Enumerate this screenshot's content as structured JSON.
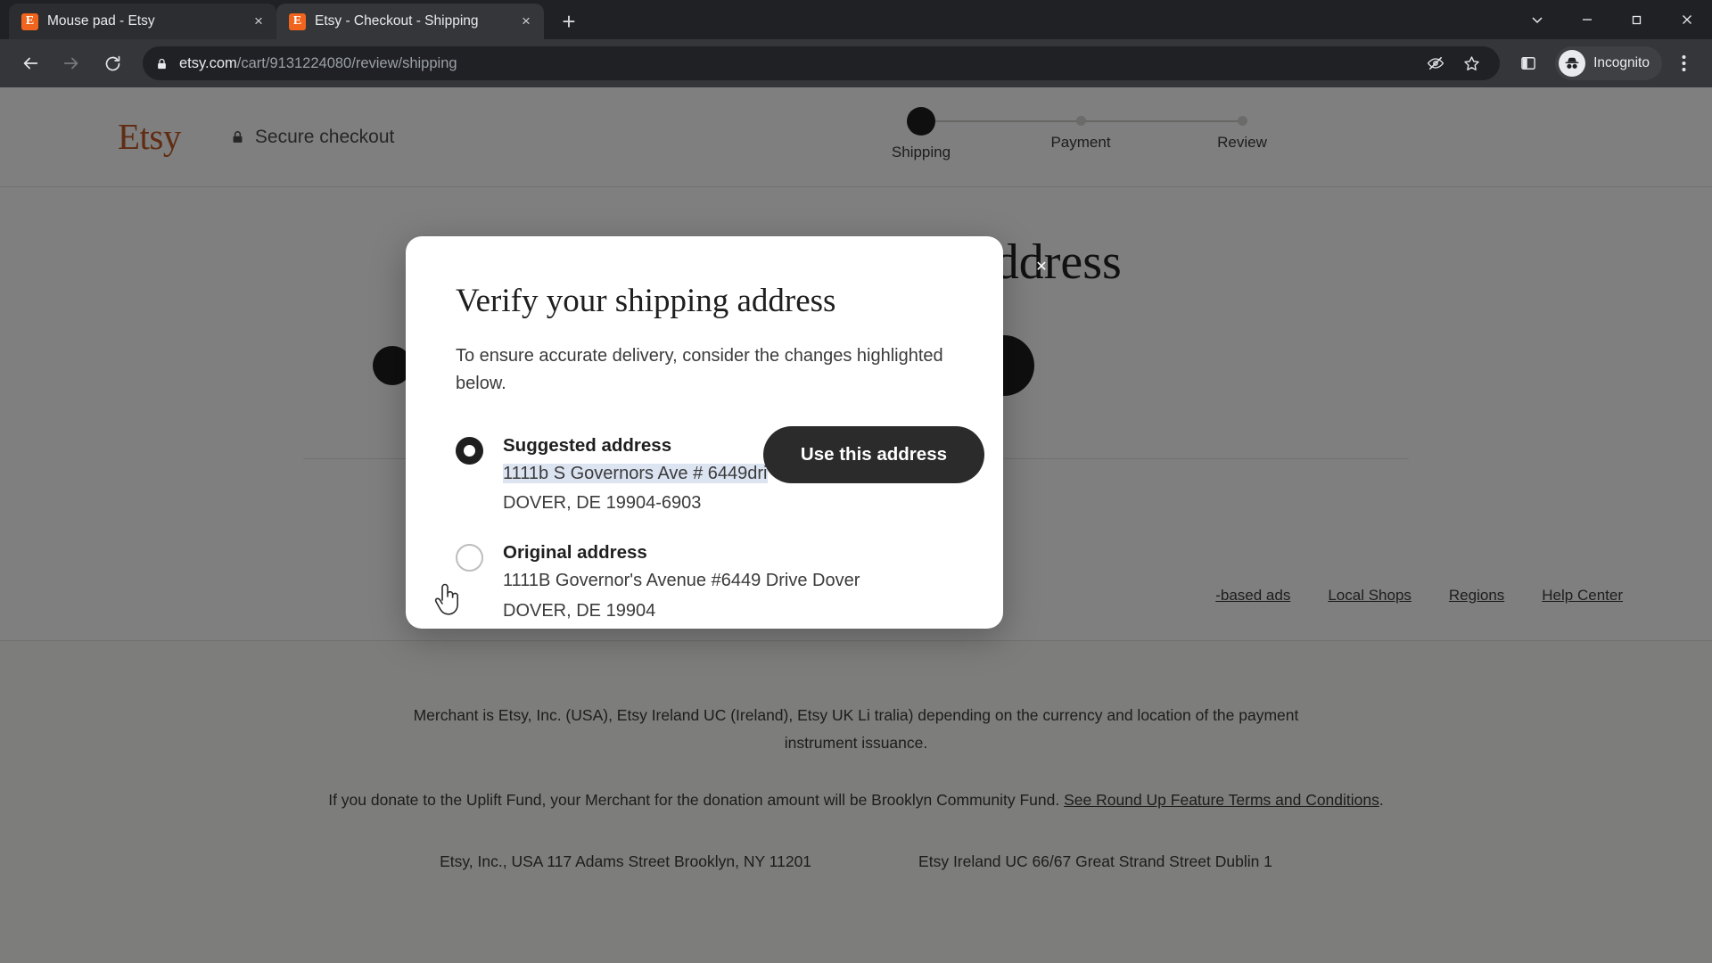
{
  "browser": {
    "tabs": [
      {
        "title": "Mouse pad - Etsy",
        "favicon": "E",
        "active": false
      },
      {
        "title": "Etsy - Checkout - Shipping",
        "favicon": "E",
        "active": true
      }
    ],
    "new_tab_label": "+",
    "close_label": "×",
    "url": {
      "host": "etsy.com",
      "path": "/cart/9131224080/review/shipping"
    },
    "profile_label": "Incognito",
    "window_controls": [
      "chevron-down",
      "minimize",
      "maximize",
      "close"
    ],
    "toolbar_icons": [
      "tracking-protection",
      "bookmark-star",
      "side-panel",
      "incognito-avatar",
      "chrome-menu"
    ]
  },
  "page": {
    "logo": "Etsy",
    "secure_checkout": "Secure checkout",
    "stepper": [
      {
        "label": "Shipping",
        "state": "active"
      },
      {
        "label": "Payment",
        "state": "upcoming"
      },
      {
        "label": "Review",
        "state": "upcoming"
      }
    ],
    "heading": "Choose a shipping address",
    "add_icon": "+",
    "footer_links": [
      "-based ads",
      "Local Shops",
      "Regions",
      "Help Center"
    ],
    "footer": {
      "legal_left": "Merchant is Etsy, Inc. (USA), Etsy Ireland UC (Ireland), Etsy UK Li",
      "legal_right": "tralia) depending on the currency and location of the payment",
      "legal_line2": "instrument issuance.",
      "uplift_pre": "If you donate to the Uplift Fund, your Merchant for the donation amount will be Brooklyn Community Fund. ",
      "uplift_link": "See Round Up Feature Terms and Conditions",
      "uplift_post": ".",
      "address_us": "Etsy, Inc., USA 117 Adams Street Brooklyn, NY 11201",
      "address_ie": "Etsy Ireland UC 66/67 Great Strand Street Dublin 1"
    }
  },
  "modal": {
    "title": "Verify your shipping address",
    "subtitle": "To ensure accurate delivery, consider the changes highlighted below.",
    "close_label": "✕",
    "primary_button": "Use this address",
    "options": [
      {
        "title": "Suggested address",
        "selected": true,
        "line1_highlighted": "1111b S Governors Ave # 6449dri",
        "line2": "DOVER, DE 19904-6903"
      },
      {
        "title": "Original address",
        "selected": false,
        "line1": "1111B Governor's Avenue #6449 Drive Dover",
        "line2": "DOVER, DE 19904"
      }
    ]
  },
  "colors": {
    "etsy_orange": "#c05b28",
    "button_dark": "#2b2b2b",
    "highlight": "#dce4f2",
    "chrome_bg": "#202124"
  }
}
